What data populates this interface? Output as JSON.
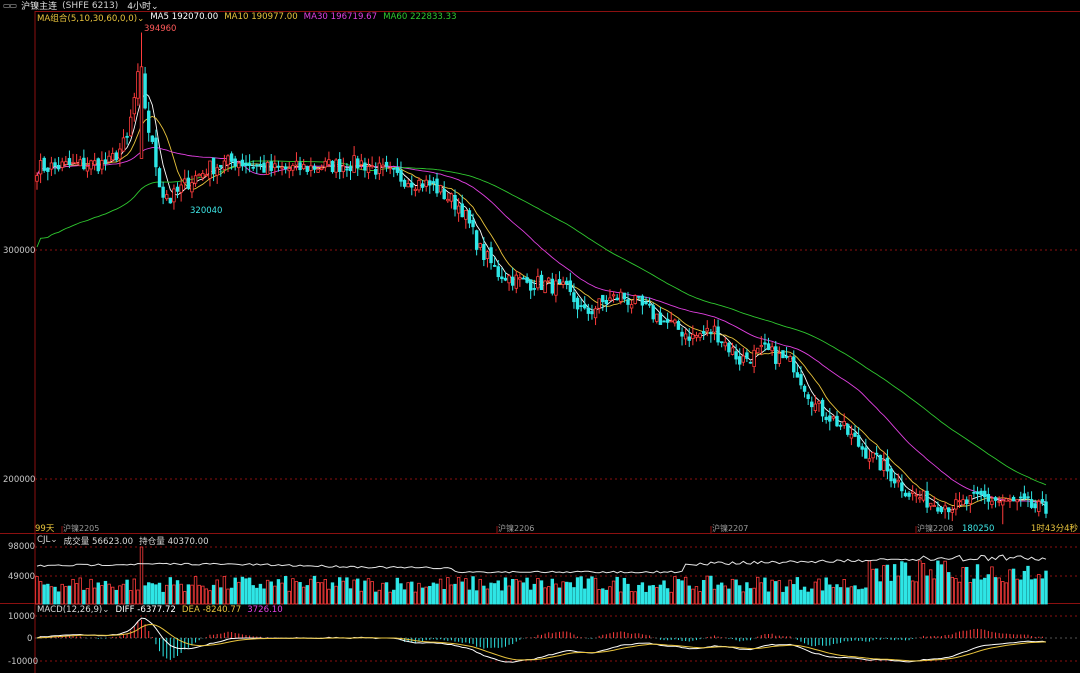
{
  "header": {
    "icon": "grid-icon",
    "title": "沪镍主连",
    "code": "(SHFE 6213)",
    "period": "4小时"
  },
  "ma_legend": {
    "group": "MA组合(5,10,30,60,0,0)",
    "items": [
      {
        "label": "MA5 192070.00",
        "color": "#ffffff"
      },
      {
        "label": "MA10 190977.00",
        "color": "#e8c33c"
      },
      {
        "label": "MA30 196719.67",
        "color": "#e040e0"
      },
      {
        "label": "MA60 222833.33",
        "color": "#2fc82f"
      }
    ]
  },
  "price_axis": {
    "labels": [
      "300000",
      "200000"
    ]
  },
  "annotations": {
    "high": "394960",
    "low_left": "320040",
    "low_right": "180250"
  },
  "time_axis": {
    "left_label": "99天",
    "ticks": [
      "沪镍2205",
      "沪镍2206",
      "沪镍2207",
      "沪镍2208"
    ],
    "countdown": "1时43分4秒"
  },
  "volume_legend": {
    "name": "CJL",
    "volume": "成交量 56623.00",
    "open_interest": "持仓量 40370.00",
    "axis": [
      "98000",
      "49000"
    ]
  },
  "macd_legend": {
    "name": "MACD(12,26,9)",
    "diff": "DIFF -6377.72",
    "dea": "DEA -8240.77",
    "macd": "3726.10",
    "axis": [
      "10000",
      "0",
      "-10000"
    ]
  },
  "colors": {
    "up": "#ff3c3c",
    "down": "#2ee6e6",
    "ma5": "#ffffff",
    "ma10": "#e8c33c",
    "ma30": "#e040e0",
    "ma60": "#2fc82f",
    "grid": "#8b1010"
  },
  "chart_data": {
    "type": "candlestick",
    "contract": "沪镍主连",
    "period": "4小时",
    "y_axis_ticks": [
      300000,
      200000
    ],
    "marked_high": 394960,
    "marked_lows": [
      320040,
      180250
    ],
    "close_path_anchors": [
      [
        0,
        336000
      ],
      [
        10,
        337000
      ],
      [
        20,
        338000
      ],
      [
        25,
        348000
      ],
      [
        28,
        375000
      ],
      [
        30,
        360000
      ],
      [
        34,
        330000
      ],
      [
        37,
        322000
      ],
      [
        42,
        330000
      ],
      [
        48,
        336000
      ],
      [
        55,
        339000
      ],
      [
        65,
        335000
      ],
      [
        75,
        336000
      ],
      [
        90,
        338000
      ],
      [
        100,
        332000
      ],
      [
        110,
        328000
      ],
      [
        118,
        318000
      ],
      [
        123,
        300000
      ],
      [
        128,
        290000
      ],
      [
        135,
        286000
      ],
      [
        142,
        285000
      ],
      [
        147,
        282000
      ],
      [
        152,
        272000
      ],
      [
        157,
        277000
      ],
      [
        162,
        280000
      ],
      [
        168,
        275000
      ],
      [
        175,
        268000
      ],
      [
        182,
        262000
      ],
      [
        188,
        265000
      ],
      [
        195,
        252000
      ],
      [
        202,
        256000
      ],
      [
        210,
        250000
      ],
      [
        216,
        232000
      ],
      [
        222,
        225000
      ],
      [
        228,
        215000
      ],
      [
        235,
        205000
      ],
      [
        242,
        194000
      ],
      [
        248,
        190000
      ],
      [
        255,
        188000
      ],
      [
        262,
        192000
      ],
      [
        268,
        190000
      ],
      [
        274,
        189000
      ],
      [
        280,
        186000
      ]
    ],
    "ma_latest": {
      "MA5": 192070.0,
      "MA10": 190977.0,
      "MA30": 196719.67,
      "MA60": 222833.33
    },
    "volume_latest": 56623.0,
    "open_interest_latest": 40370.0,
    "macd": {
      "DIFF": -6377.72,
      "DEA": -8240.77,
      "MACD": 3726.1
    }
  }
}
